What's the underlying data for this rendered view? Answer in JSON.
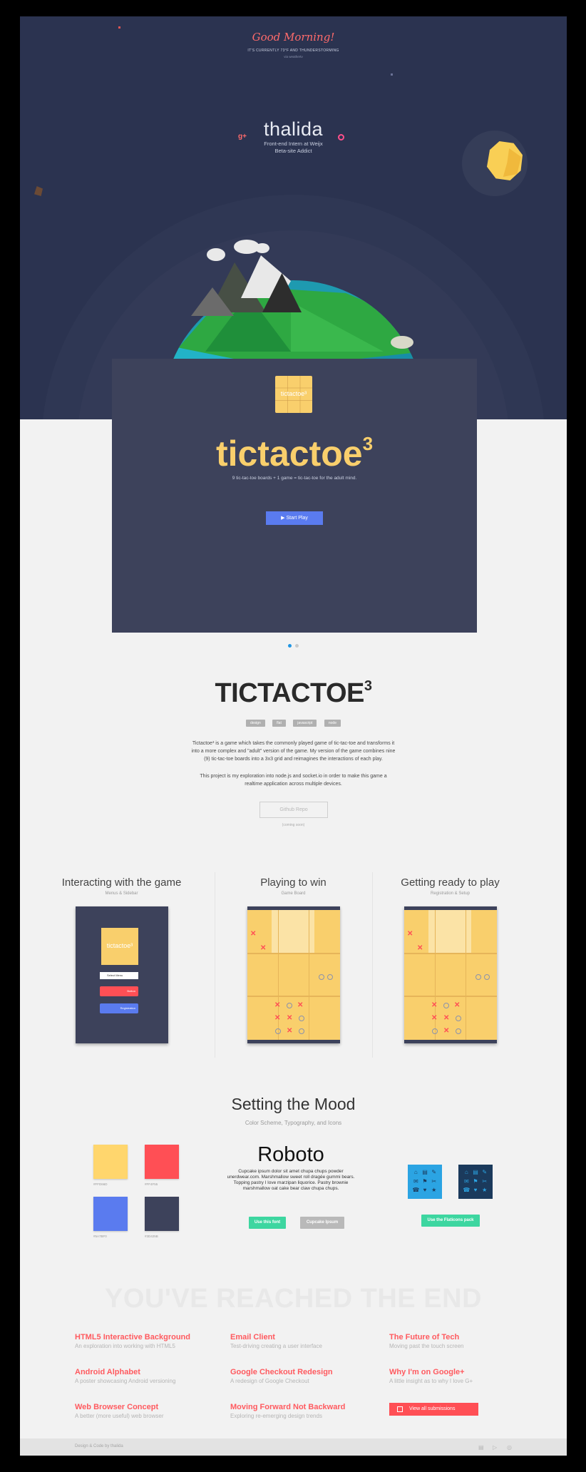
{
  "hero": {
    "greeting": "Good Morning!",
    "weather": "IT'S CURRENTLY 73°F AND THUNDERSTORMING",
    "location": "via weathertv",
    "name": "thalida",
    "role": "Front-end Intern at Weijx",
    "role2": "Beta-site Addict",
    "gplus": "g+"
  },
  "card": {
    "logo_label": "tictactoe³",
    "title": "tictactoe",
    "title_sup": "3",
    "subtitle": "9 tic-tac-toe boards  +  1 game  =  tic-tac-toe for the adult mind.",
    "start_button": "▶  Start Play"
  },
  "project": {
    "title": "TICTACTOE",
    "title_sup": "3",
    "tags": [
      "design",
      "flat",
      "javascript",
      "node"
    ],
    "desc1": "Tictactoe³ is a game which takes the commonly played game of tic-tac-toe and transforms it into a more complex and \"adult\" version of the game. My version of the game combines nine (9) tic-tac-toe boards into a 3x3 grid and reimagines the interactions of each play.",
    "desc2": "This project is my exploration into node.js and socket.io in order to make this game a realtime application across multiple devices.",
    "github": "Github Repo",
    "coming": "(coming soon)"
  },
  "screens": [
    {
      "title": "Interacting with the game",
      "sub": "Menus & Sidebar"
    },
    {
      "title": "Playing to win",
      "sub": "Game Board"
    },
    {
      "title": "Getting ready to play",
      "sub": "Registration & Setup"
    }
  ],
  "mini_menu": {
    "logo": "tictactoe³",
    "select": "Select Menu",
    "red": "Button",
    "blue": "Registration"
  },
  "mood": {
    "title": "Setting the Mood",
    "subtitle": "Color Scheme, Typography, and Icons",
    "swatches": [
      {
        "color": "#ffd66d",
        "label": "#FFD66D"
      },
      {
        "color": "#ff4f55",
        "label": "#FF4F55"
      },
      {
        "color": "#5a7bef",
        "label": "#5A7BF0"
      },
      {
        "color": "#3d425b",
        "label": "#3D425B"
      }
    ],
    "font_name": "Roboto",
    "font_sample": "Cupcake ipsum dolor sit amet chupa chups powder unerdwear.com. Marshmallow sweet roll dragée gummi bears. Topping pastry I love marzipan liquorice. Pastry brownie marshmallow oat cake bear claw chupa chups.",
    "use_font": "Use this font",
    "cupcake": "Cupcake Ipsum",
    "use_flaticons": "Use the Flaticons pack"
  },
  "end": {
    "heading": "YOU'VE REACHED THE END",
    "links": [
      {
        "title": "HTML5 Interactive Background",
        "desc": "An exploration into working with HTML5"
      },
      {
        "title": "Email Client",
        "desc": "Test-driving creating a user interface"
      },
      {
        "title": "The Future of Tech",
        "desc": "Moving past the touch screen"
      },
      {
        "title": "Android Alphabet",
        "desc": "A poster showcasing Android versioning"
      },
      {
        "title": "Google Checkout Redesign",
        "desc": "A redesign of Google Checkout"
      },
      {
        "title": "Why I'm on Google+",
        "desc": "A little insight as to why I love G+"
      },
      {
        "title": "Web Browser Concept",
        "desc": "A better (more useful) web browser"
      },
      {
        "title": "Moving Forward Not Backward",
        "desc": "Exploring re-emerging design trends"
      }
    ],
    "view_all": "View all submissions"
  },
  "footer": {
    "credit": "Design & Code by thalida"
  }
}
